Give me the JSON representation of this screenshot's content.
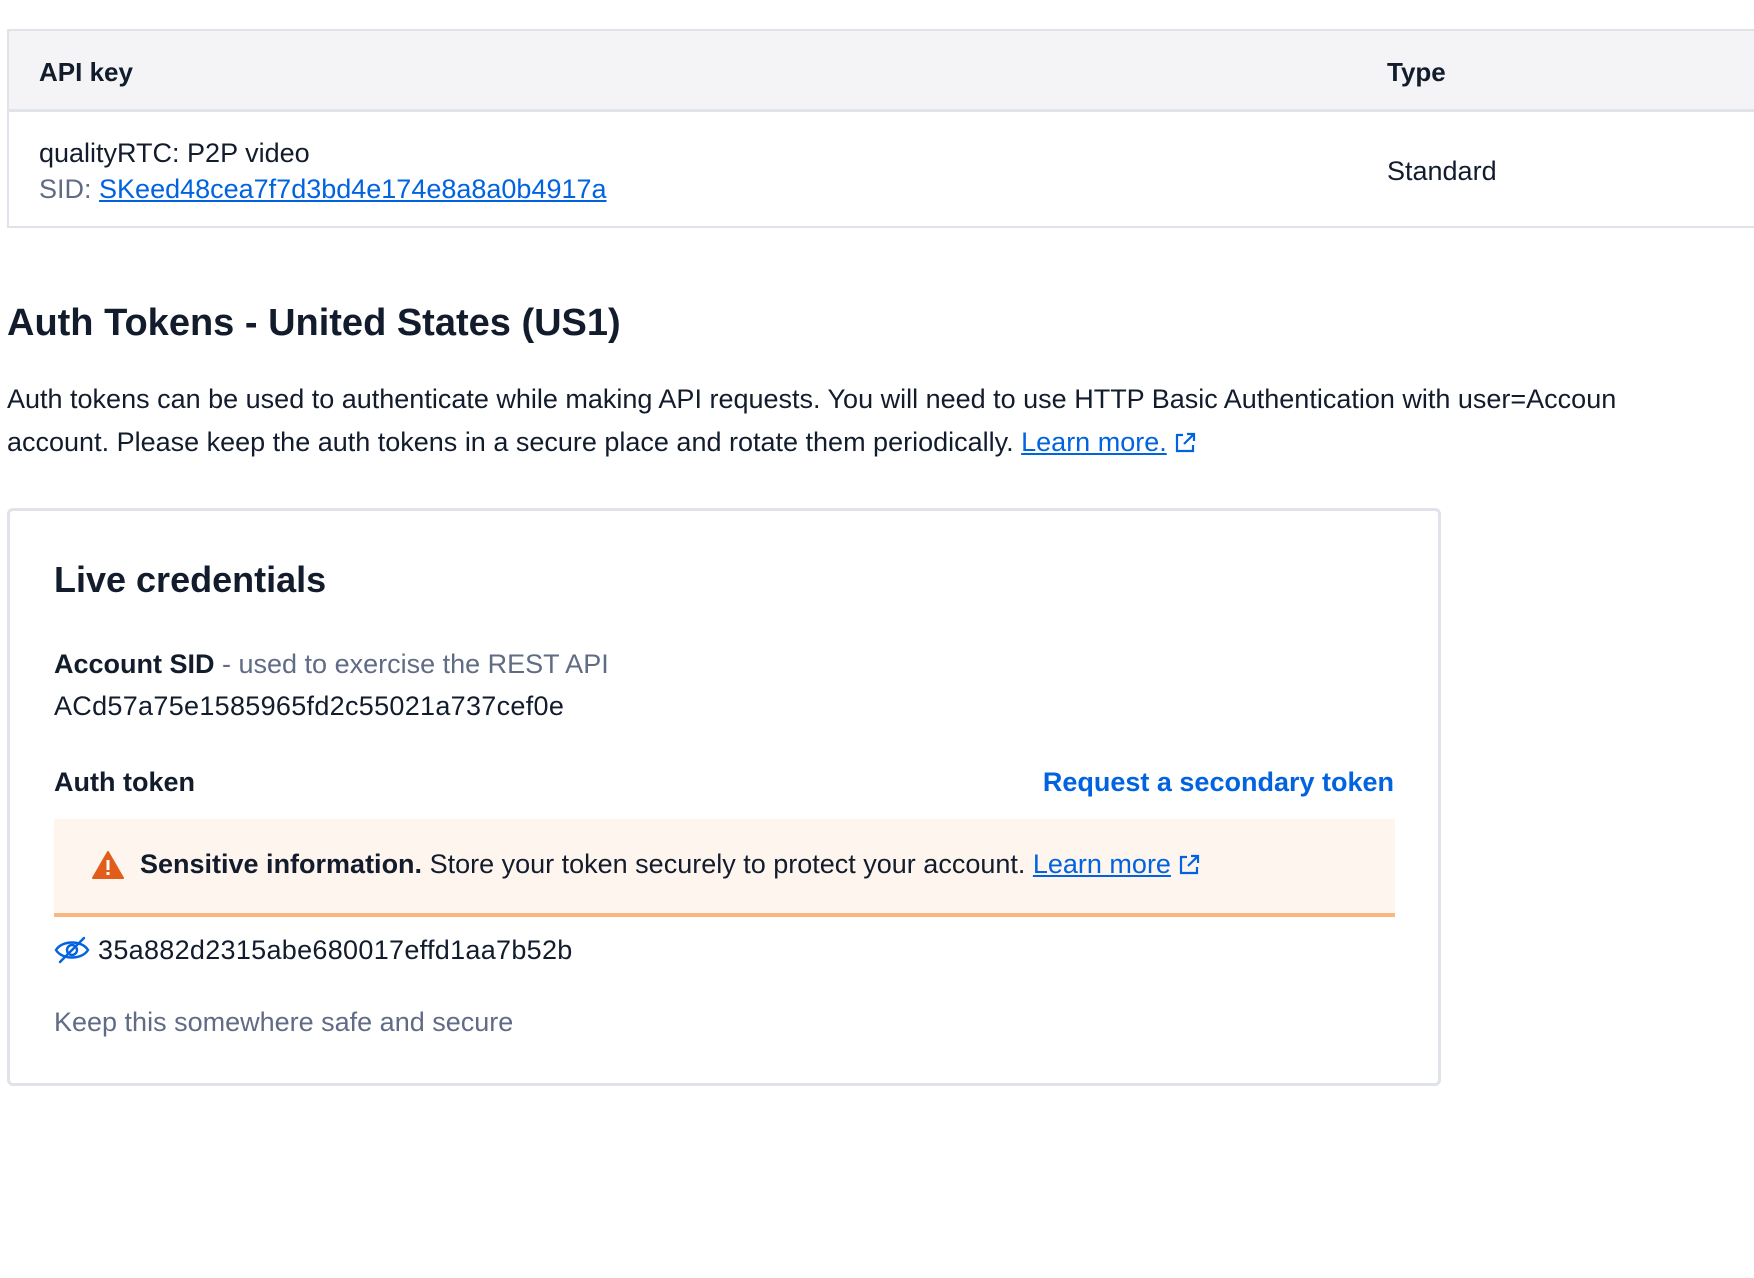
{
  "api_keys_table": {
    "headers": {
      "api_key": "API key",
      "type": "Type"
    },
    "rows": [
      {
        "name": "qualityRTC: P2P video",
        "sid_label": "SID:",
        "sid": "SKeed48cea7f7d3bd4e174e8a8a0b4917a",
        "type": "Standard"
      }
    ]
  },
  "auth_tokens": {
    "title": "Auth Tokens - United States (US1)",
    "description_line1": "Auth tokens can be used to authenticate while making API requests. You will need to use HTTP Basic Authentication with user=Accoun",
    "description_line2": "account. Please keep the auth tokens in a secure place and rotate them periodically.",
    "learn_more": "Learn more."
  },
  "live_credentials": {
    "title": "Live credentials",
    "account_sid_label": "Account SID",
    "account_sid_hint": " - used to exercise the REST API",
    "account_sid": "ACd57a75e1585965fd2c55021a737cef0e",
    "auth_token_label": "Auth token",
    "secondary_token_link": "Request a secondary token",
    "warning": {
      "bold": "Sensitive information.",
      "text": " Store your token securely to protect your account. ",
      "link": "Learn more"
    },
    "auth_token": "35a882d2315abe680017effd1aa7b52b",
    "helper_text": "Keep this somewhere safe and secure"
  },
  "colors": {
    "link": "#0263e0",
    "warning_bg": "#fef5ee",
    "warning_border": "#f9b880",
    "warning_icon": "#e25c1b",
    "muted_text": "#606b85"
  }
}
